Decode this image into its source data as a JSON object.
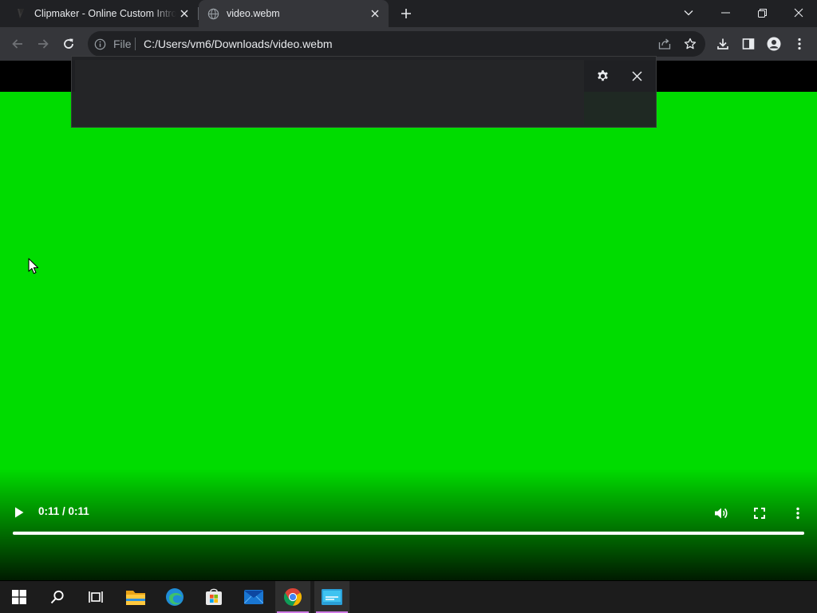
{
  "browser": {
    "tabs": [
      {
        "title": "Clipmaker - Online Custom Intro",
        "favicon": "clipmaker-logo-icon",
        "active": false
      },
      {
        "title": "video.webm",
        "favicon": "globe-icon",
        "active": true
      }
    ],
    "window_controls": [
      "tab-search-chevron-icon",
      "minimize-icon",
      "restore-icon",
      "close-icon"
    ],
    "omnibox": {
      "scheme_label": "File",
      "url": "C:/Users/vm6/Downloads/video.webm"
    },
    "toolbar_icons": [
      "back-arrow-icon",
      "forward-arrow-icon",
      "reload-icon",
      "share-icon",
      "star-icon",
      "download-icon",
      "side-panel-icon",
      "profile-icon",
      "kebab-menu-icon"
    ]
  },
  "live_caption": {
    "text": "",
    "icons": [
      "gear-icon",
      "close-icon"
    ]
  },
  "video": {
    "frame_color": "#00dc00",
    "time_display": "0:11 / 0:11",
    "progress": 1.0,
    "controls": [
      "play-icon",
      "volume-icon",
      "fullscreen-icon",
      "more-options-icon"
    ]
  },
  "taskbar": {
    "apps": [
      {
        "name": "Start",
        "icon": "windows-start-icon"
      },
      {
        "name": "Search",
        "icon": "search-icon"
      },
      {
        "name": "Task View",
        "icon": "task-view-icon"
      },
      {
        "name": "File Explorer",
        "icon": "folder-icon"
      },
      {
        "name": "Microsoft Edge",
        "icon": "edge-icon"
      },
      {
        "name": "Microsoft Store",
        "icon": "store-icon"
      },
      {
        "name": "Mail",
        "icon": "mail-icon"
      },
      {
        "name": "Google Chrome",
        "icon": "chrome-icon",
        "active": true
      },
      {
        "name": "Remote Desktop",
        "icon": "remote-desktop-icon",
        "active": true
      }
    ],
    "active_indicator_color": "#d07ce6"
  }
}
